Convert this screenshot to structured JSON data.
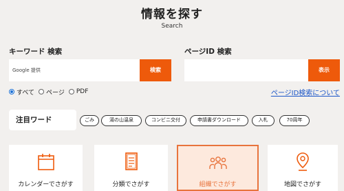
{
  "header": {
    "title": "情報を探す",
    "subtitle": "Search"
  },
  "keyword_search": {
    "label": "キーワード 検索",
    "input_value": "Google 提供",
    "button_label": "検索"
  },
  "pageid_search": {
    "label": "ページID 検索",
    "input_value": "",
    "button_label": "表示"
  },
  "scope_options": [
    {
      "label": "すべて",
      "checked": true
    },
    {
      "label": "ページ",
      "checked": false
    },
    {
      "label": "PDF",
      "checked": false
    }
  ],
  "pageid_help_link": "ページID検索について",
  "trending": {
    "label": "注目ワード",
    "tags": [
      "ごみ",
      "湯の山温泉",
      "コンビニ交付",
      "申請書ダウンロード",
      "入札",
      "70周年"
    ]
  },
  "nav_cards": [
    {
      "label": "カレンダーでさがす",
      "icon": "calendar-icon",
      "active": false
    },
    {
      "label": "分類でさがす",
      "icon": "document-list-icon",
      "active": false
    },
    {
      "label": "組織でさがす",
      "icon": "people-group-icon",
      "active": true
    },
    {
      "label": "地図でさがす",
      "icon": "map-pin-icon",
      "active": false
    }
  ],
  "colors": {
    "accent": "#ee5a0b",
    "background": "#f2f0ee",
    "link": "#1a55c8",
    "active_card_bg": "#fde9dd",
    "active_card_border": "#e8733c"
  }
}
